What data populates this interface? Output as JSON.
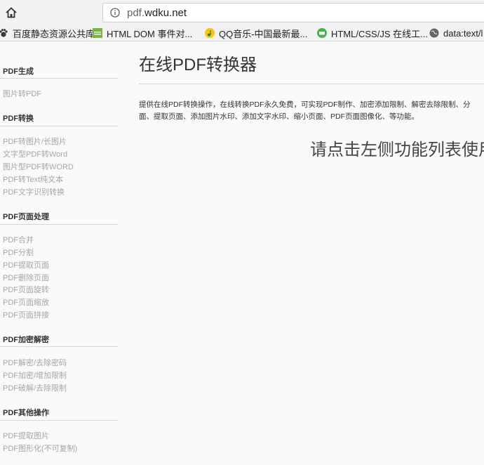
{
  "browser": {
    "url_prefix": "pdf.",
    "url_domain": "wdku.net",
    "bookmarks": [
      {
        "label": "百度静态资源公共库",
        "icon": "paw-icon"
      },
      {
        "label": "HTML DOM 事件对...",
        "icon": "green-tile-icon"
      },
      {
        "label": "QQ音乐-中国最新最...",
        "icon": "qq-music-icon"
      },
      {
        "label": "HTML/CSS/JS 在线工...",
        "icon": "green-tool-icon"
      },
      {
        "label": "data:text/l",
        "icon": "globe-icon"
      }
    ]
  },
  "sidebar": {
    "sections": [
      {
        "title": "PDF生成",
        "items": [
          "图片转PDF"
        ]
      },
      {
        "title": "PDF转换",
        "items": [
          "PDF转图片/长图片",
          "文字型PDF转Word",
          "图片型PDF转WORD",
          "PDF转Text纯文本",
          "PDF文字识别转换"
        ]
      },
      {
        "title": "PDF页面处理",
        "items": [
          "PDF合并",
          "PDF分割",
          "PDF提取页面",
          "PDF删除页面",
          "PDF页面旋转",
          "PDF页面缩放",
          "PDF页面拼接"
        ]
      },
      {
        "title": "PDF加密解密",
        "items": [
          "PDF解密/去除密码",
          "PDF加密/增加限制",
          "PDF破解/去除限制"
        ]
      },
      {
        "title": "PDF其他操作",
        "items": [
          "PDF提取图片",
          "PDF图形化(不可复制)"
        ]
      }
    ]
  },
  "main": {
    "title": "在线PDF转换器",
    "description_line1": "提供在线PDF转换操作，在线转换PDF永久免费，可实现PDF制作、加密添加限制、解密去除限制、分",
    "description_line2": "面、提取页面、添加图片水印、添加文字水印、缩小页面、PDF页面图像化、等功能。",
    "prompt": "请点击左侧功能列表使用"
  }
}
